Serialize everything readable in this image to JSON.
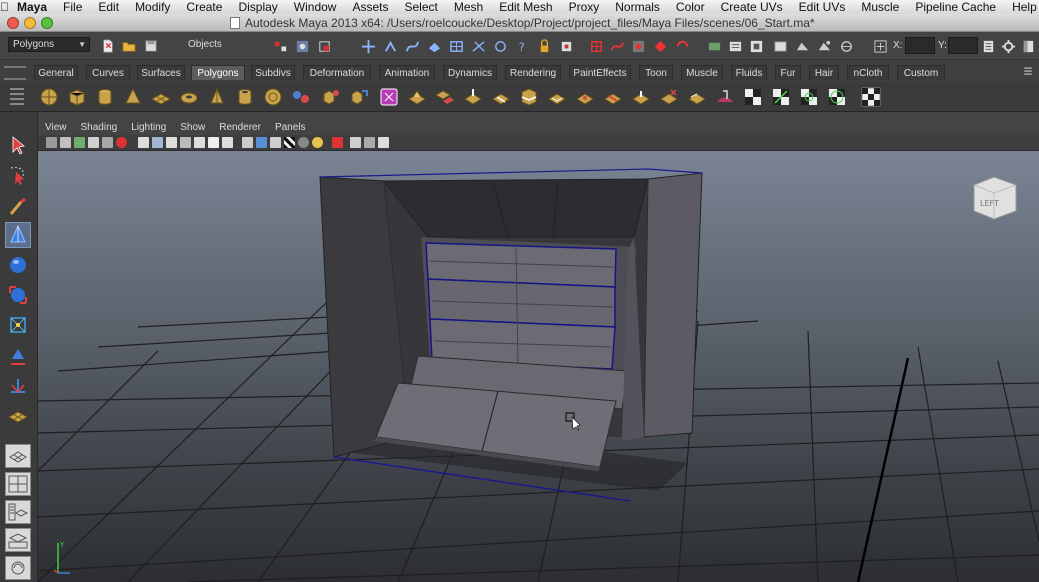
{
  "menubar": {
    "app": "Maya",
    "items": [
      "File",
      "Edit",
      "Modify",
      "Create",
      "Display",
      "Window",
      "Assets",
      "Select",
      "Mesh",
      "Edit Mesh",
      "Proxy",
      "Normals",
      "Color",
      "Create UVs",
      "Edit UVs",
      "Muscle",
      "Pipeline Cache",
      "Help"
    ]
  },
  "window": {
    "title": "Autodesk Maya 2013 x64: /Users/roelcoucke/Desktop/Project/project_files/Maya Files/scenes/06_Start.ma*"
  },
  "statusline": {
    "mode": "Polygons",
    "selection_field": "Objects",
    "x_label": "X:",
    "y_label": "Y:"
  },
  "shelf": {
    "tabs": [
      "General",
      "Curves",
      "Surfaces",
      "Polygons",
      "Subdivs",
      "Deformation",
      "Animation",
      "Dynamics",
      "Rendering",
      "PaintEffects",
      "Toon",
      "Muscle",
      "Fluids",
      "Fur",
      "Hair",
      "nCloth",
      "Custom"
    ],
    "active_tab": "Polygons"
  },
  "panel": {
    "menus": [
      "View",
      "Shading",
      "Lighting",
      "Show",
      "Renderer",
      "Panels"
    ]
  },
  "viewport": {
    "viewcube_label": "LEFT"
  },
  "colors": {
    "viewport_top": "#7a8494",
    "viewport_bottom": "#2c2e31",
    "model_face": "#5f5d66",
    "selection_edge": "#1a1a8c",
    "active_tool": "#5b6e8c"
  }
}
